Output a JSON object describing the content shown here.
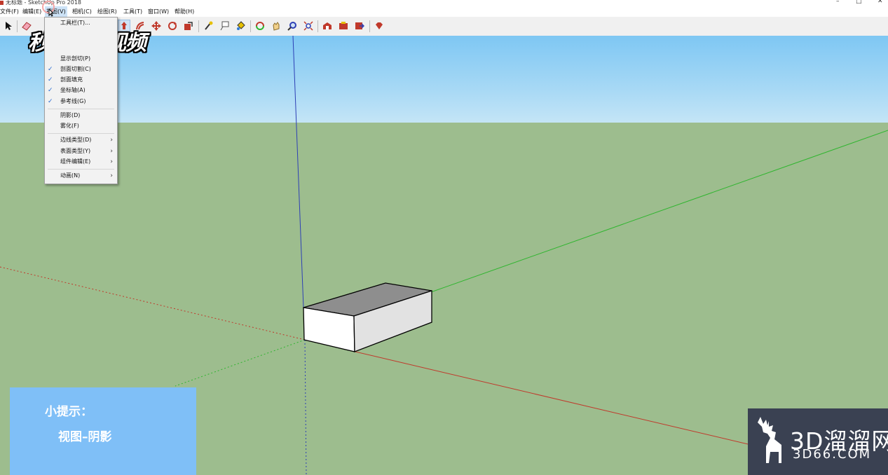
{
  "window": {
    "title": "无标题 - SketchUp Pro 2018",
    "controls": [
      "–",
      "□",
      "✕"
    ]
  },
  "menubar": [
    {
      "label": "文件(F)"
    },
    {
      "label": "编辑(E)"
    },
    {
      "label": "视图(V)"
    },
    {
      "label": "相机(C)"
    },
    {
      "label": "绘图(R)"
    },
    {
      "label": "工具(T)"
    },
    {
      "label": "窗口(W)"
    },
    {
      "label": "帮助(H)"
    }
  ],
  "toolbar_icons": [
    "select-icon",
    "eraser-icon",
    "paint-icon",
    "line-icon",
    "arc-icon",
    "shape-icon",
    "pushpull-icon",
    "offset-icon",
    "move-icon",
    "rotate-icon",
    "scale-icon",
    "tape-icon",
    "text-icon",
    "paintbucket-icon",
    "orbit-icon",
    "pan-icon",
    "zoom-icon",
    "zoom-extents-icon",
    "warehouse-icon",
    "extension-icon",
    "share-icon",
    "ruby-icon"
  ],
  "view_menu": {
    "items": [
      {
        "label": "工具栏(T)...",
        "checked": false,
        "submenu": false
      },
      {
        "label": "显示剖切(P)",
        "checked": false,
        "submenu": false
      },
      {
        "label": "剖面切割(C)",
        "checked": true,
        "submenu": false
      },
      {
        "label": "剖面填充",
        "checked": true,
        "submenu": false
      },
      {
        "label": "坐标轴(A)",
        "checked": true,
        "submenu": false
      },
      {
        "label": "参考线(G)",
        "checked": true,
        "submenu": false
      },
      {
        "label": "阴影(D)",
        "checked": false,
        "submenu": false
      },
      {
        "label": "雾化(F)",
        "checked": false,
        "submenu": false
      },
      {
        "label": "边线类型(D)",
        "checked": false,
        "submenu": true
      },
      {
        "label": "表面类型(Y)",
        "checked": false,
        "submenu": true
      },
      {
        "label": "组件编辑(E)",
        "checked": false,
        "submenu": true
      },
      {
        "label": "动画(N)",
        "checked": false,
        "submenu": true
      }
    ],
    "check_glyph": "✓",
    "submenu_glyph": "›"
  },
  "watermark": {
    "brand": "秒dong视频"
  },
  "tip": {
    "title": "小提示：",
    "text": "视图–阴影"
  },
  "corner_logo": {
    "title": "3D溜溜网",
    "subtitle": "3D66.COM"
  },
  "colors": {
    "sky": "#7ec7f3",
    "ground": "#9dbd8e",
    "tip_bg": "#7fbff7",
    "axis_red": "#c0392b",
    "axis_green": "#2fb52f",
    "axis_blue": "#2d3fb5",
    "box_top": "#8e8e8e",
    "box_front": "#ffffff",
    "box_side": "#e0e0e0"
  }
}
